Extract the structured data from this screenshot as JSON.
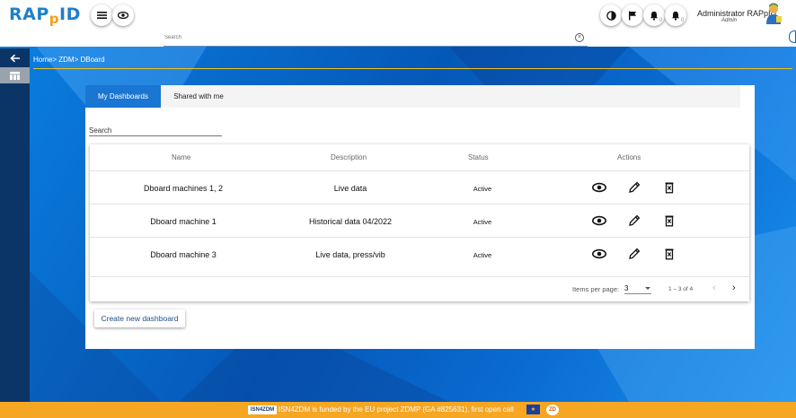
{
  "app": {
    "logo_main": "RAP",
    "logo_p": "p",
    "logo_end": "ID",
    "accent": "#1976d2",
    "sidebar_color": "#0b3566",
    "footer_color": "#f5a623"
  },
  "header": {
    "user_name": "Administrator RAPpID",
    "user_role": "Admin",
    "notif_count_1": "0",
    "notif_count_2": "0",
    "icons": [
      "menu-icon",
      "eye-icon",
      "theme-icon",
      "flag-icon",
      "bell-icon",
      "bell-alert-icon"
    ]
  },
  "search": {
    "placeholder": "Search"
  },
  "breadcrumb": "Home> ZDM> DBoard",
  "tabs": [
    {
      "label": "My Dashboards",
      "active": true
    },
    {
      "label": "Shared with me",
      "active": false
    }
  ],
  "list_search": {
    "label": "Search"
  },
  "table": {
    "headers": {
      "name": "Name",
      "description": "Description",
      "status": "Status",
      "actions": "Actions"
    },
    "rows": [
      {
        "name": "Dboard machines 1, 2",
        "description": "Live data",
        "status": "Active"
      },
      {
        "name": "Dboard machine 1",
        "description": "Historical data 04/2022",
        "status": "Active"
      },
      {
        "name": "Dboard machine 3",
        "description": "Live data, press/vib",
        "status": "Active"
      }
    ],
    "actions_icons": [
      "view-icon",
      "edit-icon",
      "delete-icon"
    ]
  },
  "paginator": {
    "items_per_page_label": "Items per page:",
    "items_per_page_value": "3",
    "range_label": "1 – 3 of 4"
  },
  "create_button": "Create new dashboard",
  "footer": {
    "isn_logo": "ISN4ZDM",
    "text": "ISN4ZDM is funded by the EU project ZDMP (GA #825631), first open call",
    "zdmp_logo": "ZD"
  }
}
